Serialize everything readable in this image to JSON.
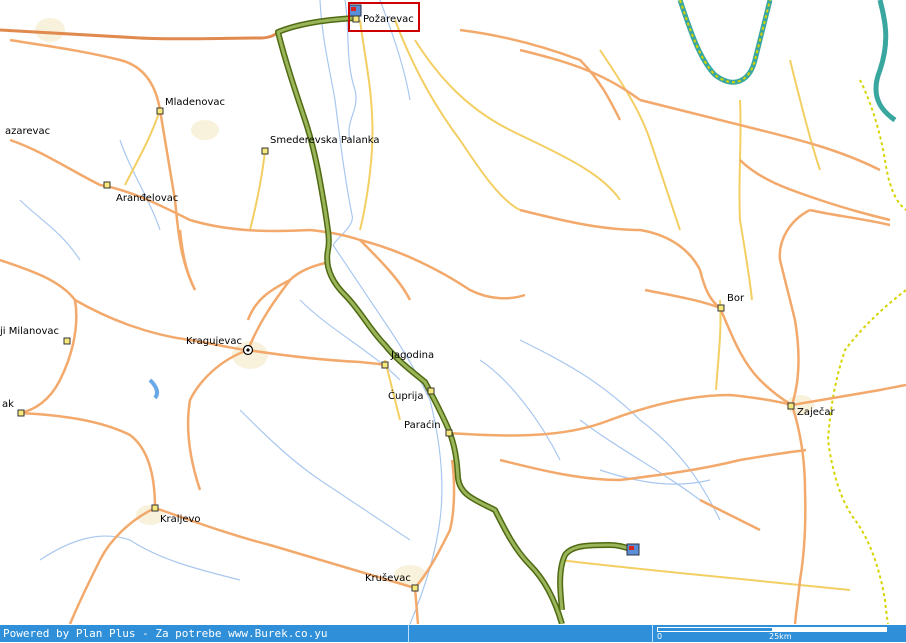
{
  "towns": [
    {
      "name": "Požarevac",
      "highlight": true
    },
    {
      "name": "Mladenovac"
    },
    {
      "name": "azarevac"
    },
    {
      "name": "Smederevska Palanka"
    },
    {
      "name": "Aranđelovac"
    },
    {
      "name": "Bor"
    },
    {
      "name": "ji Milanovac"
    },
    {
      "name": "Kragujevac",
      "capital": true
    },
    {
      "name": "Jagodina"
    },
    {
      "name": "Ćuprija"
    },
    {
      "name": "ak"
    },
    {
      "name": "Paraćin"
    },
    {
      "name": "Zaječar"
    },
    {
      "name": "Kraljevo"
    },
    {
      "name": "Kruševac"
    }
  ],
  "status_bar": {
    "powered_by": "Powered by Plan Plus - Za potrebe www.Burek.co.yu"
  },
  "scale": {
    "start": "0",
    "end": "25km"
  },
  "colors": {
    "route": "#7a9a2e",
    "road_major": "#f2a96b",
    "road_secondary": "#f3cf63",
    "highway": "#e08a4f",
    "river": "#a9c8ef",
    "border": "#d6d400",
    "water": "#3aa6a0",
    "highlight_box": "#cc0000",
    "status_bar": "#2f8fd8"
  }
}
